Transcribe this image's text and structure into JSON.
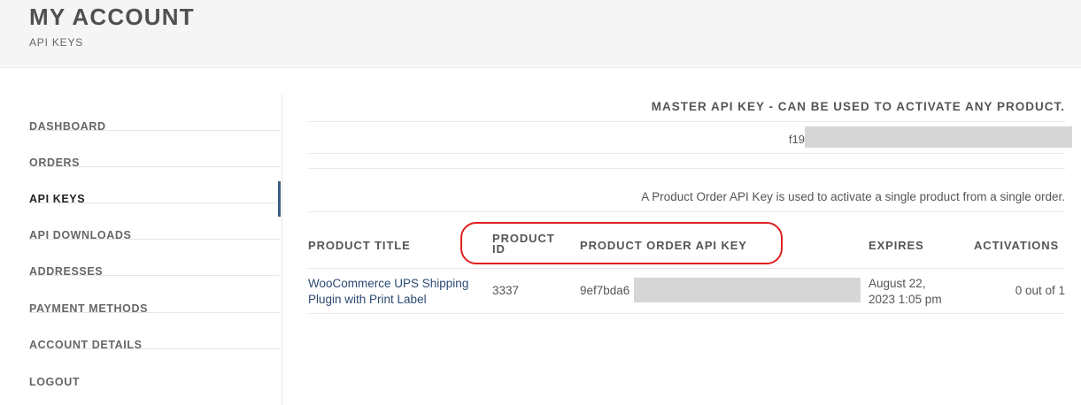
{
  "header": {
    "title": "MY ACCOUNT",
    "subtitle": "API KEYS"
  },
  "sidebar": {
    "items": [
      {
        "label": "DASHBOARD",
        "active": false
      },
      {
        "label": "ORDERS",
        "active": false
      },
      {
        "label": "API KEYS",
        "active": true
      },
      {
        "label": "API DOWNLOADS",
        "active": false
      },
      {
        "label": "ADDRESSES",
        "active": false
      },
      {
        "label": "PAYMENT METHODS",
        "active": false
      },
      {
        "label": "ACCOUNT DETAILS",
        "active": false
      },
      {
        "label": "LOGOUT",
        "active": false
      }
    ]
  },
  "main": {
    "master_title": "MASTER API KEY - CAN BE USED TO ACTIVATE ANY PRODUCT.",
    "master_key_visible": "f19",
    "product_note": "A Product Order API Key is used to activate a single product from a single order.",
    "table": {
      "columns": {
        "product_title": "PRODUCT TITLE",
        "product_id_line1": "PRODUCT",
        "product_id_line2": "ID",
        "api_key": "PRODUCT ORDER API KEY",
        "expires": "EXPIRES",
        "activations": "ACTIVATIONS"
      },
      "rows": [
        {
          "title_line1": "WooCommerce UPS Shipping",
          "title_line2": "Plugin with Print Label",
          "product_id": "3337",
          "api_key_visible": "9ef7bda6",
          "expires_line1": "August 22,",
          "expires_line2": "2023 1:05 pm",
          "activations": "0 out of 1"
        }
      ]
    }
  },
  "colors": {
    "accent": "#3d5f85",
    "link": "#2b4a73",
    "highlight": "#e02020",
    "redaction": "#d6d6d6"
  }
}
